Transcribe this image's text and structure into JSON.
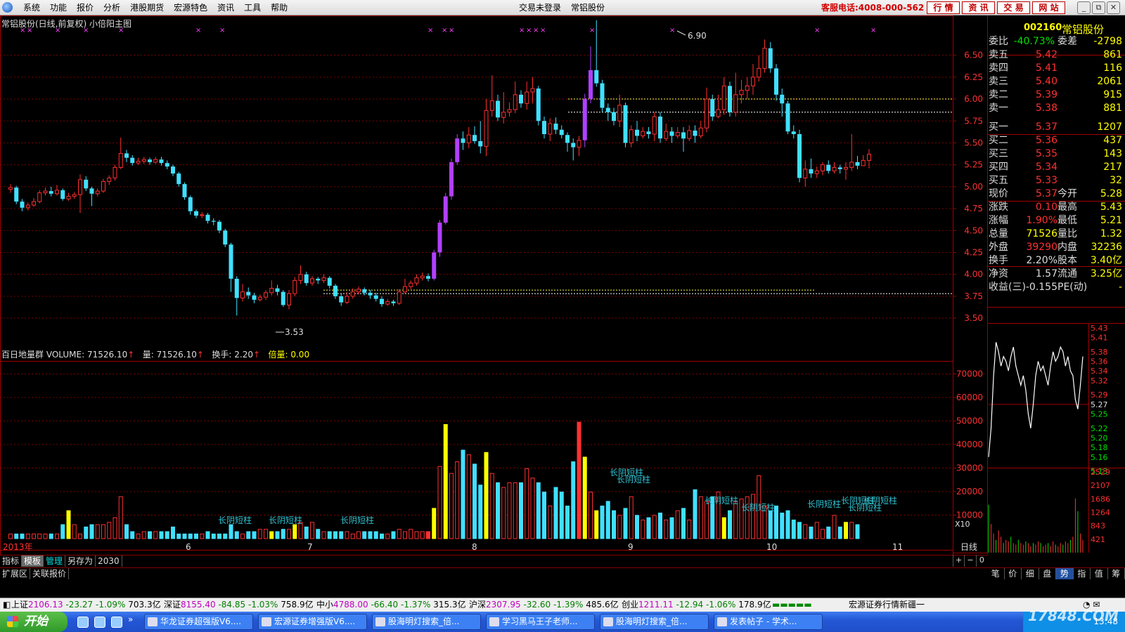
{
  "menu": {
    "items": [
      "系统",
      "功能",
      "报价",
      "分析",
      "港股期货",
      "宏源特色",
      "资讯",
      "工具",
      "帮助"
    ],
    "login_status": "交易未登录",
    "current_stock": "常铝股份",
    "hotline": "客服电话:4008-000-562",
    "buttons": [
      "行 情",
      "资 讯",
      "交 易",
      "网 站"
    ],
    "window_controls": [
      "_",
      "⧉",
      "✕"
    ]
  },
  "chart": {
    "title": "常铝股份(日线,前复权) 小倍阳主图",
    "max_label": "6.90",
    "min_label": "3.53",
    "price_ticks": [
      "6.50",
      "6.25",
      "6.00",
      "5.75",
      "5.50",
      "5.25",
      "5.00",
      "4.75",
      "4.50",
      "4.25",
      "4.00",
      "3.75",
      "3.50"
    ],
    "volume_ticks": [
      "70000",
      "60000",
      "50000",
      "40000",
      "30000",
      "20000",
      "10000"
    ],
    "volume_unit": "X10",
    "date_labels": [
      "2013年",
      "6",
      "7",
      "8",
      "9",
      "10",
      "11"
    ],
    "period": "日线",
    "annotation": "长阴短柱",
    "volume_label": {
      "name": "百日地量群",
      "volume": "VOLUME: 71526.10",
      "liang": "量: 71526.10",
      "huanshou_label": "换手:",
      "huanshou_value": "2.20",
      "beiliang_label": "倍量:",
      "beiliang_value": "0.00"
    },
    "colors": {
      "up": "#ff3030",
      "down": "#40e0ff",
      "bull_signal": "#b040ff",
      "volume_signal": "#ffff00",
      "background": "#000000"
    }
  },
  "chart_data": {
    "type": "candlestick",
    "title": "常铝股份(日线,前复权) 小倍阳主图",
    "x_period_labels": [
      "2013年",
      "6",
      "7",
      "8",
      "9",
      "10",
      "11"
    ],
    "ylim": [
      3.45,
      6.95
    ],
    "max_marked": 6.9,
    "min_marked": 3.53,
    "reference_lines": [
      6.0,
      5.85,
      3.82,
      3.78
    ],
    "candles": [
      [
        4.97,
        4.99,
        5.03,
        4.93
      ],
      [
        4.99,
        4.83,
        5.01,
        4.8
      ],
      [
        4.83,
        4.76,
        4.86,
        4.72
      ],
      [
        4.76,
        4.79,
        4.82,
        4.73
      ],
      [
        4.79,
        4.83,
        4.87,
        4.77
      ],
      [
        4.83,
        4.93,
        4.96,
        4.81
      ],
      [
        4.93,
        4.95,
        4.99,
        4.9
      ],
      [
        4.95,
        4.92,
        5.0,
        4.89
      ],
      [
        4.92,
        4.96,
        5.02,
        4.9
      ],
      [
        4.96,
        4.86,
        4.98,
        4.84
      ],
      [
        4.86,
        4.89,
        4.93,
        4.84
      ],
      [
        4.89,
        4.91,
        4.94,
        4.86
      ],
      [
        4.91,
        5.08,
        5.14,
        4.7
      ],
      [
        5.08,
        4.98,
        5.12,
        4.95
      ],
      [
        4.98,
        4.92,
        5.0,
        4.78
      ],
      [
        4.92,
        4.95,
        4.98,
        4.89
      ],
      [
        4.95,
        5.06,
        5.09,
        4.93
      ],
      [
        5.06,
        5.1,
        5.13,
        5.02
      ],
      [
        5.1,
        5.22,
        5.25,
        5.07
      ],
      [
        5.22,
        5.38,
        5.56,
        5.2
      ],
      [
        5.38,
        5.33,
        5.42,
        5.28
      ],
      [
        5.33,
        5.27,
        5.36,
        5.24
      ],
      [
        5.27,
        5.29,
        5.33,
        5.25
      ],
      [
        5.29,
        5.31,
        5.34,
        5.26
      ],
      [
        5.31,
        5.28,
        5.33,
        5.25
      ],
      [
        5.28,
        5.31,
        5.34,
        5.26
      ],
      [
        5.31,
        5.27,
        5.34,
        5.24
      ],
      [
        5.27,
        5.23,
        5.3,
        5.2
      ],
      [
        5.23,
        5.15,
        5.25,
        5.12
      ],
      [
        5.15,
        5.03,
        5.17,
        5.0
      ],
      [
        5.03,
        4.88,
        5.05,
        4.85
      ],
      [
        4.88,
        4.72,
        4.9,
        4.68
      ],
      [
        4.72,
        4.67,
        4.74,
        4.64
      ],
      [
        4.67,
        4.68,
        4.71,
        4.64
      ],
      [
        4.68,
        4.61,
        4.7,
        4.58
      ],
      [
        4.61,
        4.6,
        4.64,
        4.56
      ],
      [
        4.6,
        4.5,
        4.62,
        4.47
      ],
      [
        4.5,
        4.34,
        4.52,
        4.31
      ],
      [
        4.34,
        3.95,
        4.36,
        3.8
      ],
      [
        3.95,
        3.73,
        3.98,
        3.53
      ],
      [
        3.73,
        3.8,
        3.89,
        3.69
      ],
      [
        3.8,
        3.76,
        3.85,
        3.72
      ],
      [
        3.76,
        3.71,
        3.79,
        3.67
      ],
      [
        3.71,
        3.74,
        3.77,
        3.69
      ],
      [
        3.74,
        3.79,
        3.82,
        3.71
      ],
      [
        3.79,
        3.84,
        3.93,
        3.76
      ],
      [
        3.84,
        3.8,
        3.88,
        3.76
      ],
      [
        3.8,
        3.65,
        3.82,
        3.63
      ],
      [
        3.65,
        3.78,
        3.82,
        3.6
      ],
      [
        3.78,
        3.93,
        3.97,
        3.75
      ],
      [
        3.93,
        4.0,
        4.1,
        3.89
      ],
      [
        4.0,
        3.9,
        4.03,
        3.87
      ],
      [
        3.9,
        3.95,
        3.98,
        3.87
      ],
      [
        3.95,
        3.93,
        3.97,
        3.89
      ],
      [
        3.93,
        3.96,
        4.0,
        3.9
      ],
      [
        3.96,
        3.87,
        3.98,
        3.84
      ],
      [
        3.87,
        3.75,
        3.89,
        3.72
      ],
      [
        3.75,
        3.68,
        3.78,
        3.64
      ],
      [
        3.68,
        3.75,
        3.8,
        3.66
      ],
      [
        3.75,
        3.8,
        3.84,
        3.72
      ],
      [
        3.8,
        3.83,
        3.86,
        3.77
      ],
      [
        3.83,
        3.79,
        3.85,
        3.76
      ],
      [
        3.79,
        3.76,
        3.82,
        3.72
      ],
      [
        3.76,
        3.72,
        3.79,
        3.69
      ],
      [
        3.72,
        3.66,
        3.75,
        3.63
      ],
      [
        3.66,
        3.69,
        3.72,
        3.64
      ],
      [
        3.69,
        3.67,
        3.71,
        3.64
      ],
      [
        3.67,
        3.8,
        3.83,
        3.65
      ],
      [
        3.8,
        3.86,
        3.95,
        3.78
      ],
      [
        3.86,
        3.9,
        3.93,
        3.83
      ],
      [
        3.9,
        3.96,
        4.0,
        3.87
      ],
      [
        3.96,
        3.98,
        4.02,
        3.93
      ],
      [
        3.98,
        3.95,
        4.01,
        3.92
      ],
      [
        3.95,
        4.25,
        4.28,
        3.93
      ],
      [
        4.25,
        4.59,
        4.62,
        4.2
      ],
      [
        4.59,
        4.89,
        4.93,
        4.57
      ],
      [
        4.89,
        5.28,
        5.32,
        4.85
      ],
      [
        5.28,
        5.55,
        5.6,
        5.25
      ],
      [
        5.55,
        5.5,
        5.63,
        5.42
      ],
      [
        5.5,
        5.59,
        5.68,
        5.44
      ],
      [
        5.59,
        5.52,
        5.69,
        5.49
      ],
      [
        5.52,
        5.46,
        5.75,
        5.38
      ],
      [
        5.46,
        5.87,
        6.0,
        5.35
      ],
      [
        5.87,
        5.98,
        6.27,
        5.8
      ],
      [
        5.98,
        5.79,
        6.05,
        5.75
      ],
      [
        5.79,
        5.85,
        6.08,
        5.72
      ],
      [
        5.85,
        5.88,
        5.96,
        5.8
      ],
      [
        5.88,
        6.05,
        6.2,
        5.84
      ],
      [
        6.05,
        5.95,
        6.1,
        5.9
      ],
      [
        5.95,
        6.08,
        6.2,
        5.88
      ],
      [
        6.08,
        6.12,
        6.25,
        5.95
      ],
      [
        6.12,
        5.75,
        6.15,
        5.7
      ],
      [
        5.75,
        5.6,
        5.8,
        5.55
      ],
      [
        5.6,
        5.72,
        5.78,
        5.52
      ],
      [
        5.72,
        5.65,
        5.79,
        5.6
      ],
      [
        5.65,
        5.59,
        5.7,
        5.55
      ],
      [
        5.59,
        5.5,
        5.62,
        5.4
      ],
      [
        5.5,
        5.45,
        5.55,
        5.3
      ],
      [
        5.45,
        5.53,
        5.58,
        5.35
      ],
      [
        5.53,
        6.0,
        6.06,
        5.45
      ],
      [
        6.0,
        6.33,
        6.6,
        5.95
      ],
      [
        6.33,
        6.18,
        6.9,
        6.14
      ],
      [
        6.18,
        5.9,
        6.22,
        5.85
      ],
      [
        5.9,
        5.85,
        5.95,
        5.75
      ],
      [
        5.85,
        5.75,
        5.9,
        5.7
      ],
      [
        5.75,
        5.93,
        6.05,
        5.68
      ],
      [
        5.93,
        5.5,
        5.96,
        5.45
      ],
      [
        5.5,
        5.65,
        5.7,
        5.45
      ],
      [
        5.65,
        5.58,
        5.75,
        5.52
      ],
      [
        5.58,
        5.63,
        5.68,
        5.55
      ],
      [
        5.63,
        5.6,
        5.68,
        5.55
      ],
      [
        5.6,
        5.8,
        5.85,
        5.52
      ],
      [
        5.8,
        5.55,
        5.85,
        5.5
      ],
      [
        5.55,
        5.63,
        5.72,
        5.52
      ],
      [
        5.63,
        5.58,
        5.68,
        5.5
      ],
      [
        5.58,
        5.62,
        5.68,
        5.55
      ],
      [
        5.62,
        5.55,
        5.68,
        5.4
      ],
      [
        5.55,
        5.64,
        5.7,
        5.52
      ],
      [
        5.64,
        5.58,
        5.7,
        5.5
      ],
      [
        5.58,
        5.67,
        5.75,
        5.55
      ],
      [
        5.67,
        6.0,
        6.13,
        5.62
      ],
      [
        6.0,
        5.8,
        6.05,
        5.75
      ],
      [
        5.8,
        5.88,
        6.05,
        5.78
      ],
      [
        5.88,
        6.15,
        6.25,
        5.82
      ],
      [
        6.15,
        5.85,
        6.2,
        5.8
      ],
      [
        5.85,
        6.05,
        6.3,
        5.8
      ],
      [
        6.05,
        6.1,
        6.22,
        5.95
      ],
      [
        6.1,
        6.15,
        6.25,
        6.0
      ],
      [
        6.15,
        6.25,
        6.4,
        6.05
      ],
      [
        6.25,
        6.35,
        6.5,
        6.2
      ],
      [
        6.35,
        6.58,
        6.68,
        6.3
      ],
      [
        6.58,
        6.35,
        6.65,
        6.3
      ],
      [
        6.35,
        6.05,
        6.4,
        5.98
      ],
      [
        6.05,
        5.95,
        6.12,
        5.8
      ],
      [
        5.95,
        5.63,
        5.98,
        5.6
      ],
      [
        5.63,
        5.6,
        5.7,
        5.55
      ],
      [
        5.6,
        5.1,
        5.65,
        5.05
      ],
      [
        5.1,
        5.2,
        5.3,
        5.0
      ],
      [
        5.2,
        5.15,
        5.32,
        5.1
      ],
      [
        5.15,
        5.18,
        5.23,
        5.1
      ],
      [
        5.18,
        5.25,
        5.28,
        5.13
      ],
      [
        5.25,
        5.18,
        5.3,
        5.15
      ],
      [
        5.18,
        5.22,
        5.28,
        5.15
      ],
      [
        5.22,
        5.2,
        5.25,
        5.15
      ],
      [
        5.2,
        5.22,
        5.28,
        5.08
      ],
      [
        5.22,
        5.28,
        5.6,
        5.18
      ],
      [
        5.28,
        5.24,
        5.35,
        5.2
      ],
      [
        5.24,
        5.3,
        5.36,
        5.25
      ],
      [
        5.3,
        5.37,
        5.43,
        5.21
      ]
    ],
    "volume": [
      2,
      2,
      2,
      2,
      2,
      2,
      2,
      2,
      2,
      6,
      12,
      6,
      2,
      5,
      6,
      6,
      6,
      7,
      9,
      18,
      6,
      3,
      2,
      3,
      3,
      3,
      3,
      3,
      5,
      2,
      2,
      2,
      2,
      2,
      3,
      2,
      2,
      2,
      6,
      3,
      2,
      3,
      3,
      4,
      4,
      3,
      3,
      4,
      4,
      6,
      7,
      5,
      7,
      4,
      3,
      3,
      3,
      3,
      3,
      2,
      3,
      3,
      3,
      3,
      2,
      2,
      3,
      4,
      3,
      4,
      3,
      3,
      3,
      13,
      31,
      49,
      28,
      33,
      38,
      36,
      32,
      23,
      37,
      28,
      24,
      22,
      24,
      24,
      24,
      30,
      26,
      24,
      20,
      14,
      22,
      20,
      14,
      33,
      50,
      35,
      20,
      12,
      14,
      16,
      12,
      10,
      13,
      18,
      10,
      8,
      9,
      10,
      11,
      8,
      9,
      12,
      13,
      8,
      21,
      18,
      16,
      18,
      20,
      9,
      12,
      16,
      17,
      18,
      19,
      27,
      14,
      12,
      14,
      11,
      12,
      8,
      7,
      6,
      5,
      7,
      4,
      5,
      10,
      5,
      7,
      7,
      6
    ],
    "volume_scale": "X10",
    "ylim_volume": [
      0,
      75000
    ]
  },
  "quote": {
    "code": "002160",
    "name": "常铝股份",
    "weibi_label": "委比",
    "weibi_value": "-40.73%",
    "weicha_label": "委差",
    "weicha_value": "-2798",
    "asks": [
      {
        "label": "卖五",
        "price": "5.42",
        "vol": "861"
      },
      {
        "label": "卖四",
        "price": "5.41",
        "vol": "116"
      },
      {
        "label": "卖三",
        "price": "5.40",
        "vol": "2061"
      },
      {
        "label": "卖二",
        "price": "5.39",
        "vol": "915"
      },
      {
        "label": "卖一",
        "price": "5.38",
        "vol": "881"
      }
    ],
    "bids": [
      {
        "label": "买一",
        "price": "5.37",
        "vol": "1207"
      },
      {
        "label": "买二",
        "price": "5.36",
        "vol": "437"
      },
      {
        "label": "买三",
        "price": "5.35",
        "vol": "143"
      },
      {
        "label": "买四",
        "price": "5.34",
        "vol": "217"
      },
      {
        "label": "买五",
        "price": "5.33",
        "vol": "32"
      }
    ],
    "stats": [
      {
        "l1": "现价",
        "v1": "5.37",
        "l2": "今开",
        "v2": "5.28"
      },
      {
        "l1": "涨跌",
        "v1": "0.10",
        "l2": "最高",
        "v2": "5.43"
      },
      {
        "l1": "涨幅",
        "v1": "1.90%",
        "l2": "最低",
        "v2": "5.21"
      },
      {
        "l1": "总量",
        "v1": "71526",
        "l2": "量比",
        "v2": "1.32"
      },
      {
        "l1": "外盘",
        "v1": "39290",
        "l2": "内盘",
        "v2": "32236"
      }
    ],
    "stats2": [
      {
        "l1": "换手",
        "v1": "2.20%",
        "l2": "股本",
        "v2": "3.40亿"
      },
      {
        "l1": "净资",
        "v1": "1.57",
        "l2": "流通",
        "v2": "3.25亿"
      },
      {
        "l1": "收益(三)",
        "v1": "-0.155",
        "l2": "PE(动)",
        "v2": "-"
      }
    ]
  },
  "minichart": {
    "price_ticks": [
      "5.43",
      "5.41",
      "5.38",
      "5.36",
      "5.34",
      "5.32",
      "5.29",
      "5.27",
      "5.25",
      "5.22",
      "5.20",
      "5.18",
      "5.16",
      "5.13"
    ],
    "volume_ticks": [
      "2529",
      "2107",
      "1686",
      "1264",
      "843",
      "421"
    ],
    "ylim": [
      5.11,
      5.43
    ],
    "prev_close": 5.27,
    "price_line": [
      5.16,
      5.22,
      5.33,
      5.4,
      5.38,
      5.35,
      5.37,
      5.36,
      5.34,
      5.37,
      5.39,
      5.35,
      5.33,
      5.31,
      5.33,
      5.3,
      5.25,
      5.22,
      5.27,
      5.33,
      5.36,
      5.34,
      5.35,
      5.33,
      5.31,
      5.35,
      5.38,
      5.36,
      5.37,
      5.39,
      5.38,
      5.35,
      5.37,
      5.34,
      5.33,
      5.28,
      5.26,
      5.31,
      5.37
    ],
    "volume_bars": [
      1500,
      900,
      600,
      400,
      700,
      500,
      300,
      400,
      350,
      500,
      300,
      250,
      400,
      300,
      250,
      350,
      300,
      200,
      300,
      250,
      350,
      300,
      200,
      250,
      300,
      200,
      350,
      250,
      200,
      300,
      250,
      350,
      300,
      400,
      500,
      1700,
      1300,
      600,
      400
    ]
  },
  "tabs": {
    "row1": [
      "指标",
      "模板",
      "管理",
      "另存为",
      "2030"
    ],
    "row2": [
      "扩展区",
      "关联报价"
    ],
    "kline_tools": [
      "+",
      "−",
      "0"
    ],
    "right": [
      "笔",
      "价",
      "细",
      "盘",
      "势",
      "指",
      "值",
      "筹"
    ]
  },
  "ticker": {
    "items": [
      {
        "name": "上证",
        "price": "2106.13",
        "chg": "-23.27",
        "pct": "-1.09%",
        "amt": "703.3亿"
      },
      {
        "name": "深证",
        "price": "8155.40",
        "chg": "-84.85",
        "pct": "-1.03%",
        "amt": "758.9亿"
      },
      {
        "name": "中小",
        "price": "4788.00",
        "chg": "-66.40",
        "pct": "-1.37%",
        "amt": "315.3亿"
      },
      {
        "name": "沪深",
        "price": "2307.95",
        "chg": "-32.60",
        "pct": "-1.39%",
        "amt": "485.6亿"
      },
      {
        "name": "创业",
        "price": "1211.11",
        "chg": "-12.94",
        "pct": "-1.06%",
        "amt": "178.9亿"
      }
    ],
    "message": "宏源证券行情新疆一"
  },
  "taskbar": {
    "start": "开始",
    "tasks": [
      "华龙证券超强版V6....",
      "宏源证券增强版V6....",
      "股海明灯搜索_倍...",
      "学习黑马王子老师...",
      "股海明灯搜索_倍...",
      "发表帖子 - 学术..."
    ],
    "clock": "13:48",
    "watermark": "17848.COM"
  }
}
